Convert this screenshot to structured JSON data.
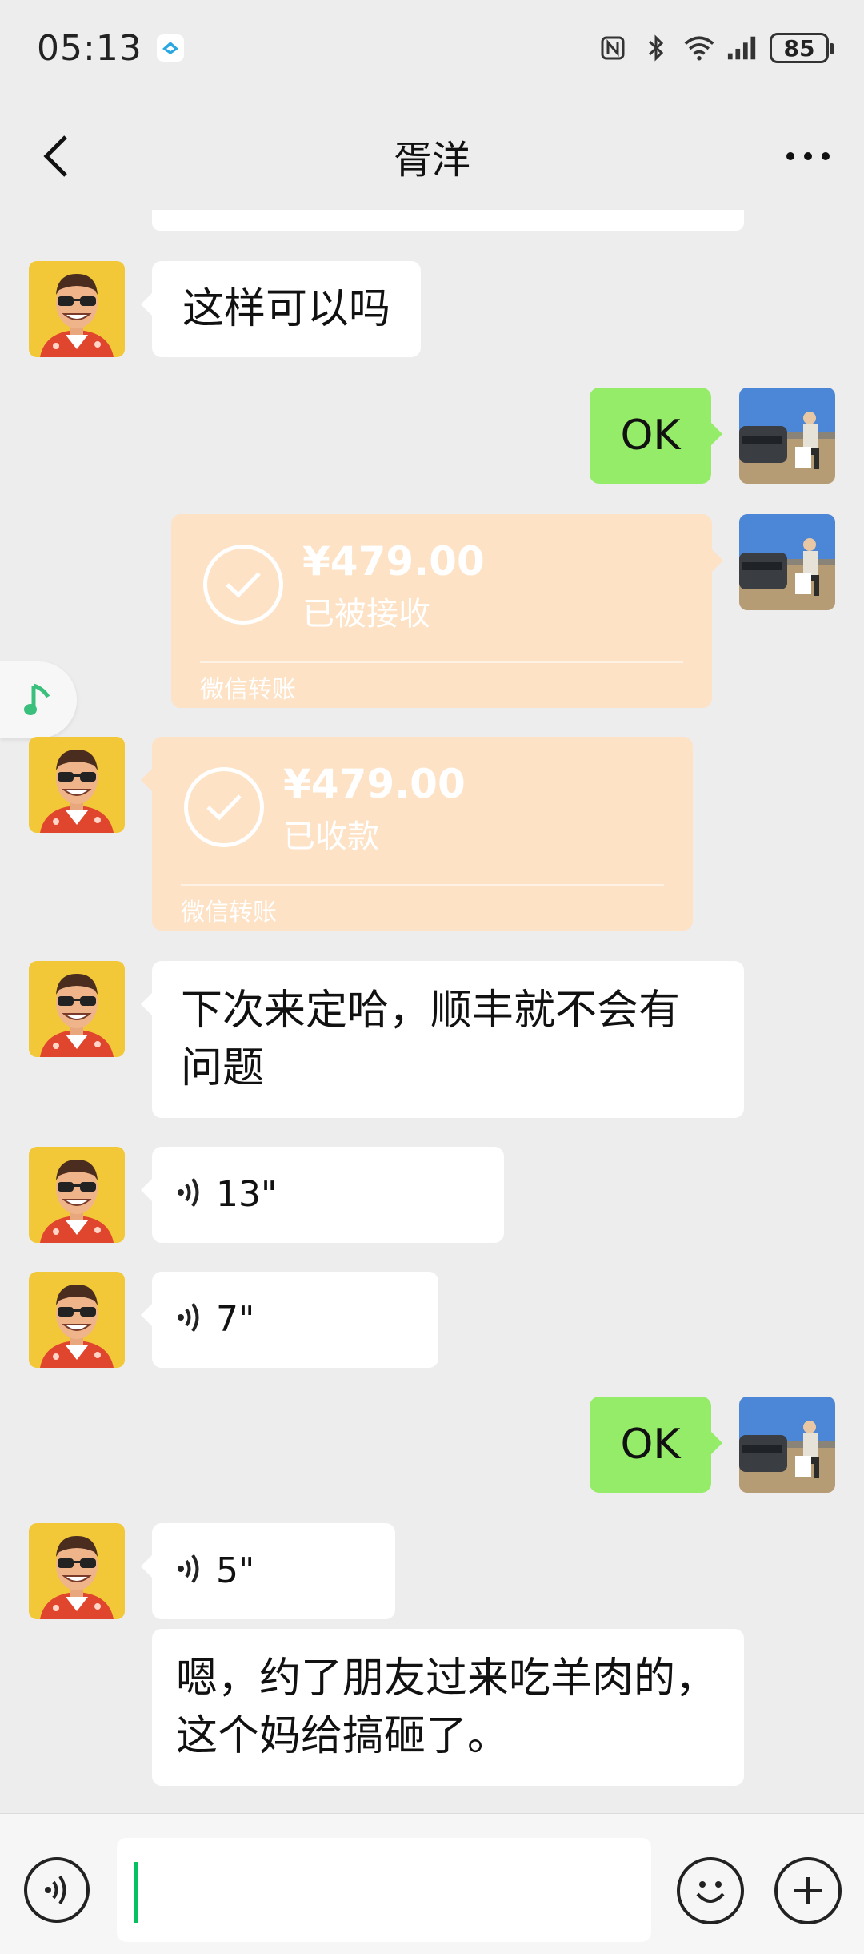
{
  "status_bar": {
    "time": "05:13",
    "battery": "85",
    "icons": [
      "app-icon",
      "nfc-icon",
      "bluetooth-icon",
      "wifi-icon",
      "signal-icon",
      "battery-icon"
    ]
  },
  "nav": {
    "title": "胥洋",
    "back_icon": "chevron-left-icon",
    "more_icon": "more-dots-icon"
  },
  "messages": [
    {
      "side": "left",
      "type": "text",
      "text": "这样可以吗"
    },
    {
      "side": "right",
      "type": "text",
      "text": "OK"
    },
    {
      "side": "right",
      "type": "transfer",
      "amount": "¥479.00",
      "status": "已被接收",
      "footer": "微信转账"
    },
    {
      "side": "left",
      "type": "transfer",
      "amount": "¥479.00",
      "status": "已收款",
      "footer": "微信转账"
    },
    {
      "side": "left",
      "type": "text",
      "line1": "下次来定哈，顺丰就不会有",
      "line2": "问题"
    },
    {
      "side": "left",
      "type": "voice",
      "duration": "13\""
    },
    {
      "side": "left",
      "type": "voice",
      "duration": "7\""
    },
    {
      "side": "right",
      "type": "text",
      "text": "OK"
    },
    {
      "side": "left",
      "type": "voice",
      "duration": "5\""
    },
    {
      "side": "left",
      "type": "text",
      "line1": "嗯，约了朋友过来吃羊肉的，",
      "line2": "这个妈给搞砸了。"
    }
  ],
  "colors": {
    "background": "#ededed",
    "bubble_left": "#ffffff",
    "bubble_right": "#95ec69",
    "transfer": "#fde2c5",
    "cursor": "#07c160"
  },
  "input_bar": {
    "voice_icon": "voice-mode-icon",
    "emoji_icon": "emoji-icon",
    "plus_icon": "plus-icon"
  }
}
